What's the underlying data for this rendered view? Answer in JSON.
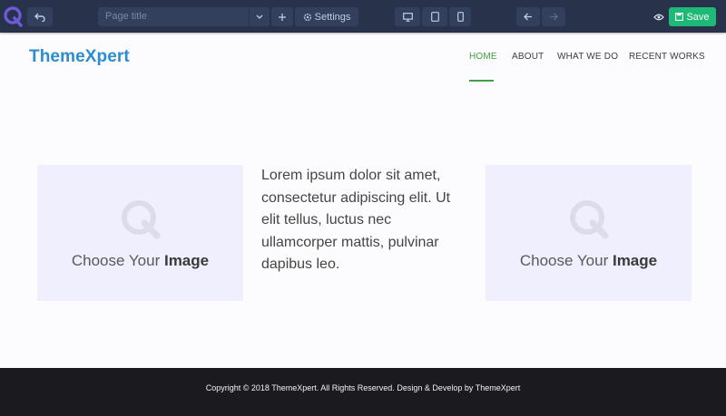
{
  "toolbar": {
    "logo_icon": "quix-logo-icon",
    "undo_icon": "undo-icon",
    "page_title_placeholder": "Page title",
    "dropdown_icon": "chevron-down-icon",
    "add_icon": "plus-icon",
    "settings_label": "Settings",
    "settings_icon": "gear-icon",
    "devices": [
      "desktop-icon",
      "tablet-icon",
      "mobile-icon"
    ],
    "back_icon": "arrow-left-icon",
    "forward_icon": "arrow-right-icon",
    "preview_icon": "eye-icon",
    "save_label": "Save",
    "save_icon": "save-icon",
    "colors": {
      "bar": "#28324a",
      "button": "#33405d",
      "save": "#1fb977"
    }
  },
  "site": {
    "brand": "ThemeXpert",
    "brand_color": "#2b8ccf",
    "nav": [
      {
        "label": "HOME",
        "active": true
      },
      {
        "label": "ABOUT",
        "active": false
      },
      {
        "label": "WHAT WE DO",
        "active": false
      },
      {
        "label": "RECENT WORKS",
        "active": false
      }
    ],
    "active_color": "#3da140"
  },
  "content": {
    "image_left": {
      "caption_light": "Choose Your ",
      "caption_bold": "Image",
      "icon": "image-placeholder-q-icon"
    },
    "text": "Lorem ipsum dolor sit amet, consectetur adipiscing elit. Ut elit tellus, luctus nec ullamcorper mattis, pulvinar dapibus leo.",
    "image_right": {
      "caption_light": "Choose Your ",
      "caption_bold": "Image",
      "icon": "image-placeholder-q-icon"
    }
  },
  "footer": {
    "text": "Copyright © 2018 ThemeXpert. All Rights Reserved. Design & Develop by ThemeXpert"
  }
}
